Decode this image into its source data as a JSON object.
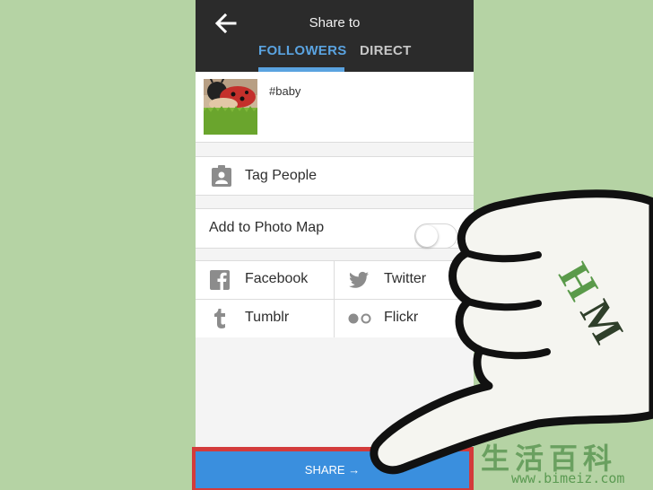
{
  "header": {
    "title": "Share to",
    "tabs": [
      {
        "label": "FOLLOWERS",
        "active": true
      },
      {
        "label": "DIRECT",
        "active": false
      }
    ]
  },
  "post": {
    "caption": "#baby"
  },
  "options": {
    "tag_people": "Tag People",
    "photo_map": {
      "label": "Add to Photo Map",
      "enabled": false
    }
  },
  "networks": [
    {
      "label": "Facebook",
      "icon": "facebook-icon"
    },
    {
      "label": "Twitter",
      "icon": "twitter-icon"
    },
    {
      "label": "Tumblr",
      "icon": "tumblr-icon"
    },
    {
      "label": "Flickr",
      "icon": "flickr-icon"
    }
  ],
  "share_button": {
    "label": "SHARE →"
  },
  "watermark": {
    "chinese": "生活百科",
    "url": "www.bimeiz.com",
    "logo_text": "HM"
  },
  "colors": {
    "background": "#b5d3a4",
    "header": "#2b2b2b",
    "accent": "#5aa3e0",
    "share_button": "#3a8fde",
    "highlight_border": "#d33b3b"
  }
}
